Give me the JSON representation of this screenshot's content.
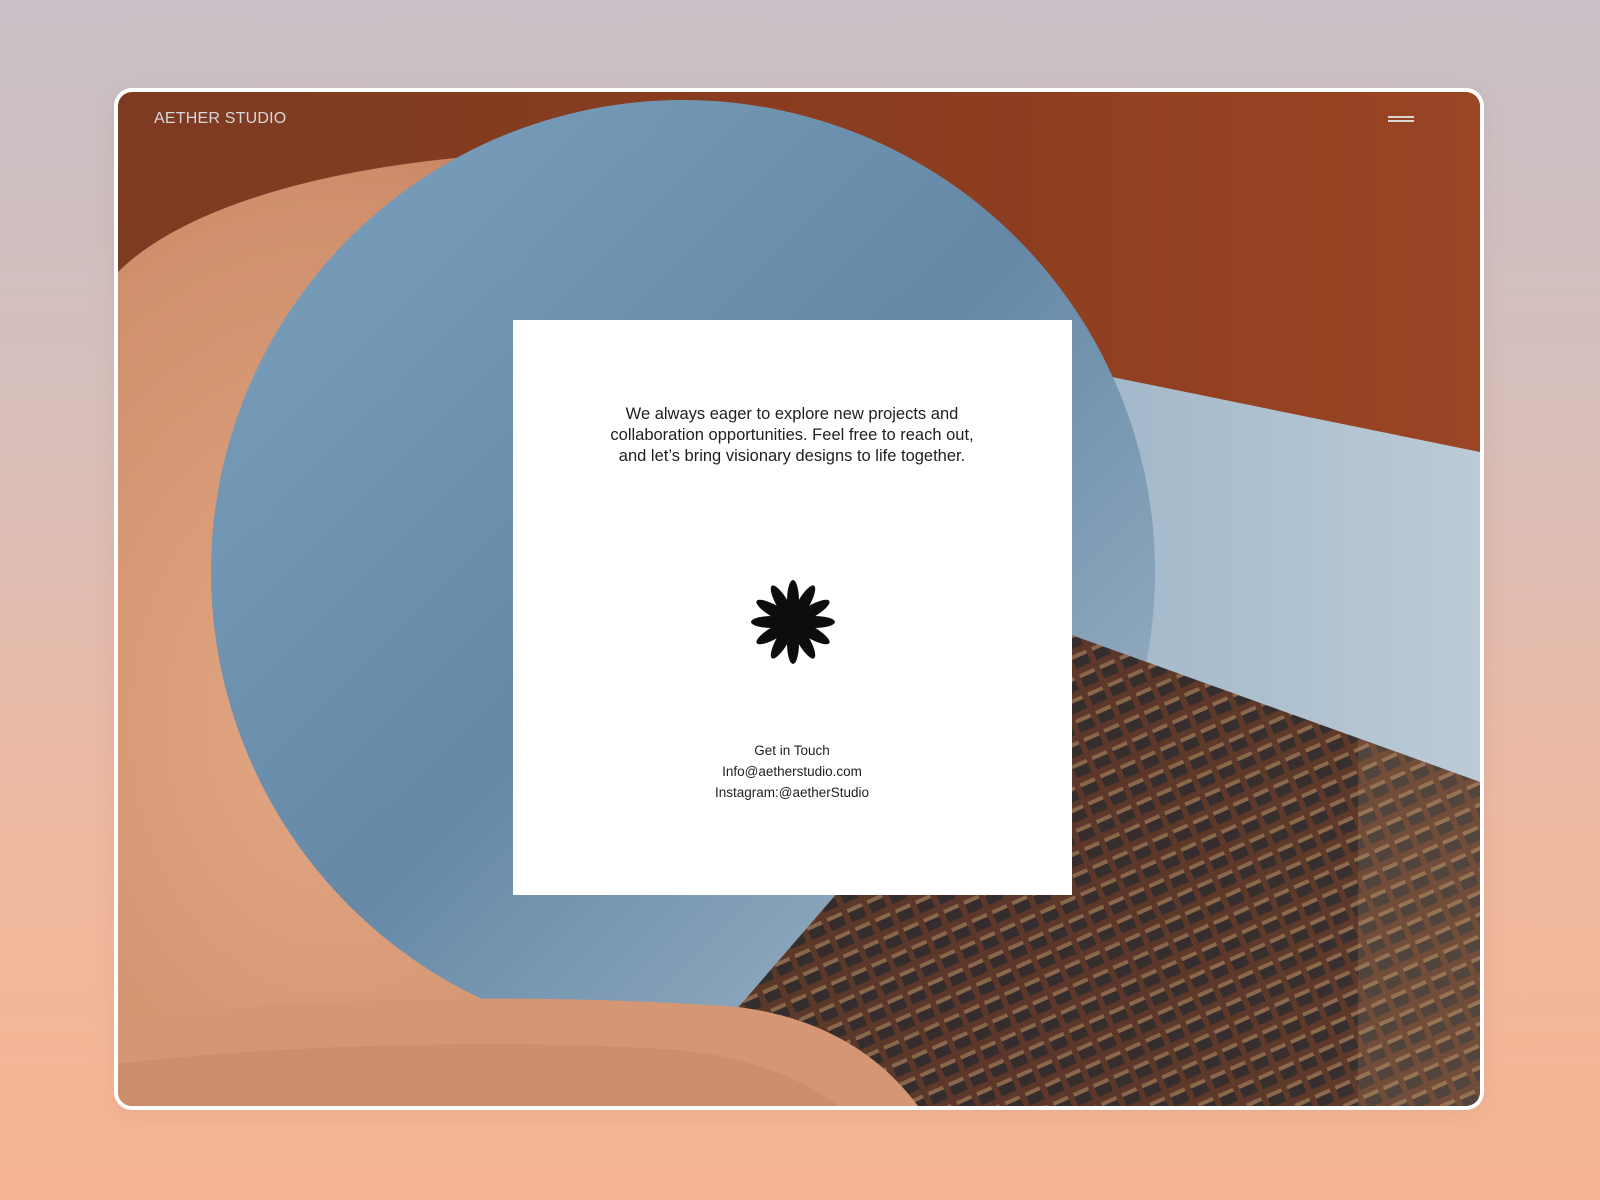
{
  "header": {
    "brand": "AETHER STUDIO",
    "menu_icon": "hamburger-menu-icon"
  },
  "card": {
    "intro": "We always eager to explore new projects and collaboration opportunities. Feel free to reach out, and let’s bring visionary designs to life together.",
    "logo_icon": "flower-asterisk-icon",
    "contact": {
      "heading": "Get in Touch",
      "email": "Info@aetherstudio.com",
      "instagram": "Instagram:@aetherStudio"
    }
  },
  "colors": {
    "page_gradient_top": "#c8c0c6",
    "page_gradient_bottom": "#f6b592",
    "wall_terracotta": "#8e3f20",
    "wall_peach": "#d89a77",
    "sky_blue": "#6f92ad",
    "tower_brown": "#6a4232",
    "card_bg": "#ffffff",
    "text": "#1f1f1f"
  }
}
